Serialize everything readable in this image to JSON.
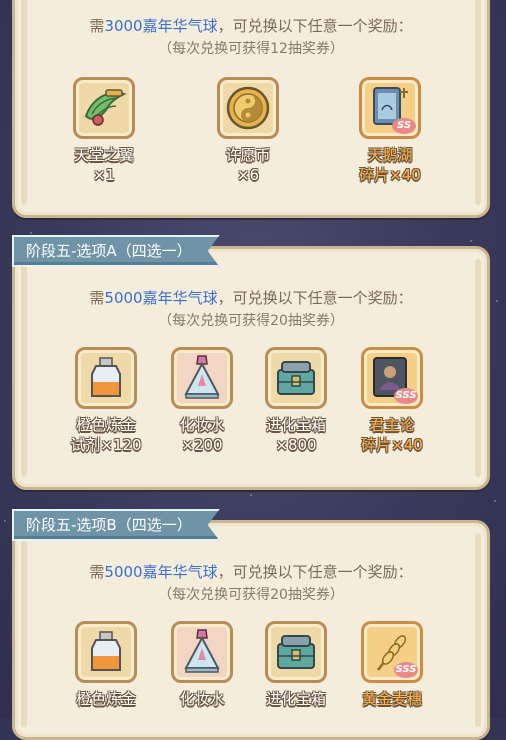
{
  "sections": [
    {
      "tag": "",
      "need_prefix": "需",
      "need_amount": "3000嘉年华气球",
      "need_suffix": "，可兑换以下任意一个奖励：",
      "note": "（每次兑换可获得12抽奖券）",
      "items": [
        {
          "icon": "wing-icon",
          "name": "天堂之翼",
          "qty": "×1",
          "highlight": false
        },
        {
          "icon": "coin-icon",
          "name": "许愿币",
          "qty": "×6",
          "highlight": false
        },
        {
          "icon": "swan-lake-card-icon",
          "name": "天鹅湖",
          "qty": "碎片×40",
          "highlight": true,
          "badge": "SS"
        }
      ]
    },
    {
      "tag": "阶段五-选项A（四选一）",
      "need_prefix": "需",
      "need_amount": "5000嘉年华气球",
      "need_suffix": "，可兑换以下任意一个奖励：",
      "note": "（每次兑换可获得20抽奖券）",
      "items": [
        {
          "icon": "orange-potion-icon",
          "name": "橙色炼金",
          "qty": "试剂×120",
          "highlight": false
        },
        {
          "icon": "cosmetic-bottle-icon",
          "name": "化妆水",
          "qty": "×200",
          "highlight": false
        },
        {
          "icon": "evolution-chest-icon",
          "name": "进化宝箱",
          "qty": "×800",
          "highlight": false
        },
        {
          "icon": "monarch-card-icon",
          "name": "君主论",
          "qty": "碎片×40",
          "highlight": true,
          "badge": "SSS"
        }
      ]
    },
    {
      "tag": "阶段五-选项B（四选一）",
      "need_prefix": "需",
      "need_amount": "5000嘉年华气球",
      "need_suffix": "，可兑换以下任意一个奖励：",
      "note": "（每次兑换可获得20抽奖券）",
      "items": [
        {
          "icon": "orange-potion-icon",
          "name": "橙色炼金",
          "qty": "",
          "highlight": false
        },
        {
          "icon": "cosmetic-bottle-icon",
          "name": "化妆水",
          "qty": "",
          "highlight": false
        },
        {
          "icon": "evolution-chest-icon",
          "name": "进化宝箱",
          "qty": "",
          "highlight": false
        },
        {
          "icon": "golden-wheat-icon",
          "name": "黄金麦穗",
          "qty": "",
          "highlight": true,
          "badge": "SSS"
        }
      ]
    }
  ],
  "colors": {
    "amount": "#3a6fd0",
    "highlight": "#ffb44a",
    "tag_bg": "#6f94a8",
    "panel_bg": "#f4eddb"
  }
}
